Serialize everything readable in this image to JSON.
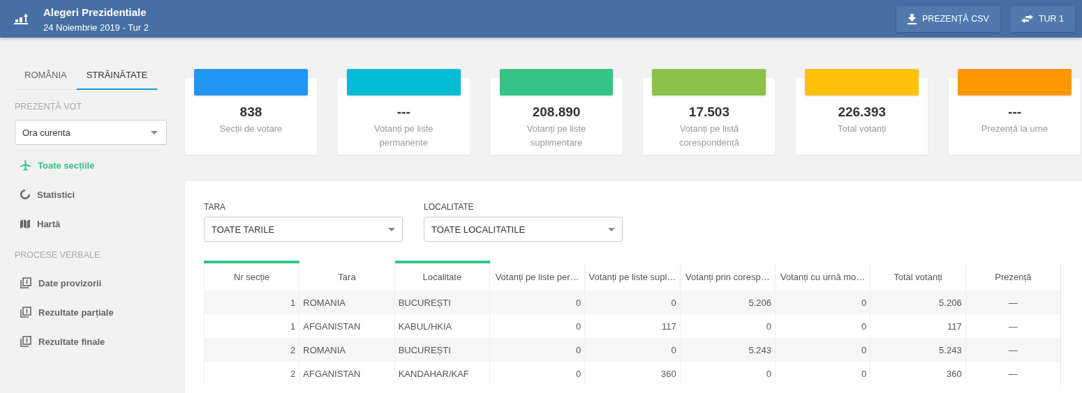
{
  "header": {
    "title": "Alegeri Prezidentiale",
    "subtitle": "24 Noiembrie 2019 - Tur 2",
    "buttons": [
      {
        "label": "PREZENȚĂ CSV",
        "kind": "download"
      },
      {
        "label": "TUR 1",
        "kind": "swap"
      }
    ]
  },
  "sidebar": {
    "tabs": [
      {
        "label": "ROMÂNIA",
        "selected": false
      },
      {
        "label": "STRĂINĂTATE",
        "selected": true
      }
    ],
    "sections": [
      {
        "heading": "PREZENȚĂ VOT",
        "dropdown": {
          "value": "Ora curenta"
        },
        "items": [
          {
            "label": "Toate secțiile",
            "kind": "plane",
            "selected": true
          },
          {
            "label": "Statistici",
            "kind": "ring",
            "selected": false
          },
          {
            "label": "Hartă",
            "kind": "map",
            "selected": false
          }
        ]
      },
      {
        "heading": "PROCESE VERBALE",
        "items": [
          {
            "label": "Date provizorii",
            "kind": "pages",
            "selected": false
          },
          {
            "label": "Rezultate parțiale",
            "kind": "pages",
            "selected": false
          },
          {
            "label": "Rezultate finale",
            "kind": "pages",
            "selected": false
          }
        ]
      }
    ]
  },
  "stats": [
    {
      "value": "838",
      "label": "Secții de votare",
      "color": "#2196f3"
    },
    {
      "value": "---",
      "label": "Votanți pe liste permanente",
      "color": "#00bcd4"
    },
    {
      "value": "208.890",
      "label": "Votanți pe liste suplimentare",
      "color": "#35c486"
    },
    {
      "value": "17.503",
      "label": "Votanți pe listă corespondență",
      "color": "#8bc34a"
    },
    {
      "value": "226.393",
      "label": "Total votanți",
      "color": "#ffc107"
    },
    {
      "value": "---",
      "label": "Prezență la urne",
      "color": "#ff9800"
    }
  ],
  "filters": [
    {
      "label": "TARA",
      "value": "TOATE TARILE"
    },
    {
      "label": "LOCALITATE",
      "value": "TOATE LOCALITATILE"
    }
  ],
  "table": {
    "columns": [
      {
        "label": "Nr secție",
        "sorted": true
      },
      {
        "label": "Tara",
        "sorted": false
      },
      {
        "label": "Localitate",
        "sorted": true
      },
      {
        "label": "Votanți pe liste per…",
        "sorted": false
      },
      {
        "label": "Votanți pe liste supl…",
        "sorted": false
      },
      {
        "label": "Votanți prin coresp…",
        "sorted": false
      },
      {
        "label": "Votanți cu urnă mo…",
        "sorted": false
      },
      {
        "label": "Total votanți",
        "sorted": false
      },
      {
        "label": "Prezență",
        "sorted": false
      }
    ],
    "rows": [
      [
        "1",
        "ROMANIA",
        "BUCUREȘTI",
        "0",
        "0",
        "5.206",
        "0",
        "5.206",
        "—"
      ],
      [
        "1",
        "AFGANISTAN",
        "KABUL/HKIA",
        "0",
        "117",
        "0",
        "0",
        "117",
        "—"
      ],
      [
        "2",
        "ROMANIA",
        "BUCUREȘTI",
        "0",
        "0",
        "5.243",
        "0",
        "5.243",
        "—"
      ],
      [
        "2",
        "AFGANISTAN",
        "KANDAHAR/KAF",
        "0",
        "360",
        "0",
        "0",
        "360",
        "—"
      ]
    ]
  }
}
